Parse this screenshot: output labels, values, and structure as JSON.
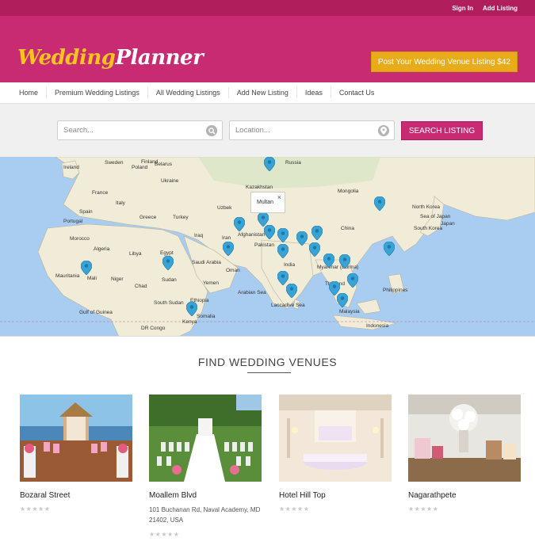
{
  "topbar": {
    "sign_in": "Sign In",
    "add_listing": "Add Listing"
  },
  "brand": {
    "word1": "Wedding",
    "word2": "Planner"
  },
  "cta": {
    "label": "Post Your Wedding Venue Listing $42"
  },
  "nav": [
    "Home",
    "Premium Wedding Listings",
    "All Wedding Listings",
    "Add New Listing",
    "Ideas",
    "Contact Us"
  ],
  "search": {
    "keyword_placeholder": "Search...",
    "location_placeholder": "Location...",
    "button": "SEARCH LISTING"
  },
  "map": {
    "tooltip_text": "Multan",
    "tooltip_close": "×",
    "labels": [
      "Sweden",
      "Finland",
      "Russia",
      "Kazakhstan",
      "Mongolia",
      "Ireland",
      "Poland",
      "Belarus",
      "Ukraine",
      "France",
      "Spain",
      "Portugal",
      "Italy",
      "Turkey",
      "Uzbek",
      "Greece",
      "Morocco",
      "Algeria",
      "Libya",
      "Egypt",
      "Iraq",
      "Iran",
      "Afghanistan",
      "Pakistan",
      "China",
      "North Korea",
      "South Korea",
      "Japan",
      "Sea of Japan",
      "Saudi Arabia",
      "Mauritania",
      "Mali",
      "Niger",
      "Chad",
      "Sudan",
      "Yemen",
      "India",
      "Myanmar (Burma)",
      "Thailand",
      "Philippines",
      "Arabian Sea",
      "Laccadive Sea",
      "Malaysia",
      "Indonesia",
      "South Sudan",
      "Ethiopia",
      "Somalia",
      "Kenya",
      "Gulf of Guinea",
      "DR Congo",
      "Oman"
    ]
  },
  "section": {
    "title": "FIND WEDDING VENUES"
  },
  "venues": [
    {
      "name": "Bozaral Street",
      "address": "",
      "stars": "★★★★★"
    },
    {
      "name": "Moallem Blvd",
      "address": "101 Buchanan Rd, Naval Academy, MD 21402, USA",
      "stars": "★★★★★"
    },
    {
      "name": "Hotel Hill Top",
      "address": "",
      "stars": "★★★★★"
    },
    {
      "name": "Nagarathpete",
      "address": "",
      "stars": "★★★★★"
    }
  ],
  "colors": {
    "brand": "#c92b73",
    "topbar": "#b01f5c",
    "cta": "#e8ac1b",
    "logo_accent": "#f7c51e",
    "pin": "#3aa3d6",
    "ocean": "#a9cdf0",
    "land": "#f1ecd7"
  }
}
